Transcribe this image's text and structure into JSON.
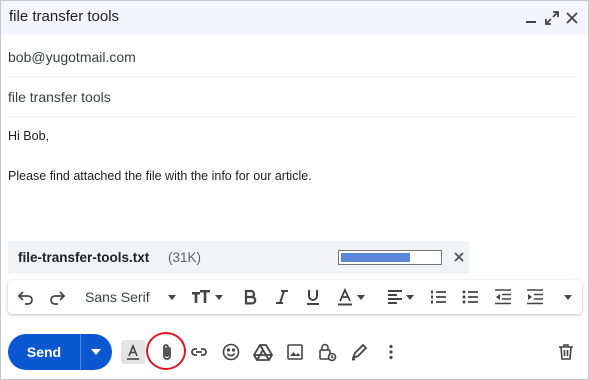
{
  "window": {
    "title": "file transfer tools",
    "controls": [
      "minimize-icon",
      "expand-icon",
      "close-icon"
    ]
  },
  "recipients": "bob@yugotmail.com",
  "subject": "file transfer tools",
  "body": {
    "lines": [
      "Hi Bob,",
      "Please find attached the file with the info for our article."
    ]
  },
  "attachment": {
    "name": "file-transfer-tools.txt",
    "size": "(31K)",
    "upload_progress": 0.7
  },
  "format_toolbar": {
    "font": "Sans Serif",
    "icons": [
      "undo-icon",
      "redo-icon",
      "font-dropdown-icon",
      "text-size-icon",
      "bold-icon",
      "italic-icon",
      "underline-icon",
      "text-color-icon",
      "align-icon",
      "numbered-list-icon",
      "bulleted-list-icon",
      "indent-less-icon",
      "indent-more-icon",
      "more-formatting-icon"
    ]
  },
  "bottom_bar": {
    "send_label": "Send",
    "icons": [
      "formatting-options-icon",
      "attach-icon",
      "link-icon",
      "emoji-icon",
      "drive-icon",
      "photo-icon",
      "confidential-icon",
      "signature-icon",
      "more-options-icon",
      "discard-icon"
    ]
  },
  "colors": {
    "send_button": "#0b57d0",
    "header_bg": "#f2f6fc",
    "progress_fill": "#5b85d9",
    "highlight_circle": "#e0141e"
  }
}
